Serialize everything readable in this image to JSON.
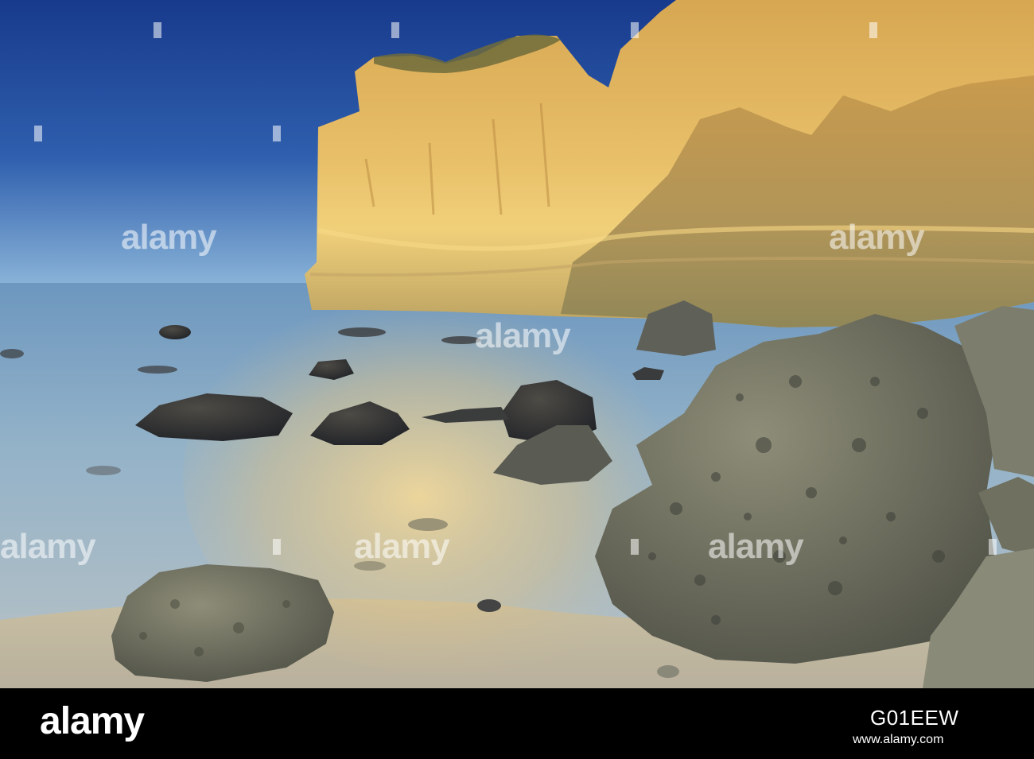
{
  "watermark": {
    "text": "alamy"
  },
  "footer": {
    "logo_text": "alamy",
    "image_id": "G01EEW",
    "url": "www.alamy.com"
  },
  "colors": {
    "sky_top": "#1b3c8e",
    "sky_bottom": "#6d9fcf",
    "sea": "#8fb2cc",
    "cliff_lit": "#e6b765",
    "cliff_shadow": "#9a8a55",
    "rock": "#6f705f",
    "sand": "#d8c7a0",
    "footer_bg": "#000000"
  }
}
